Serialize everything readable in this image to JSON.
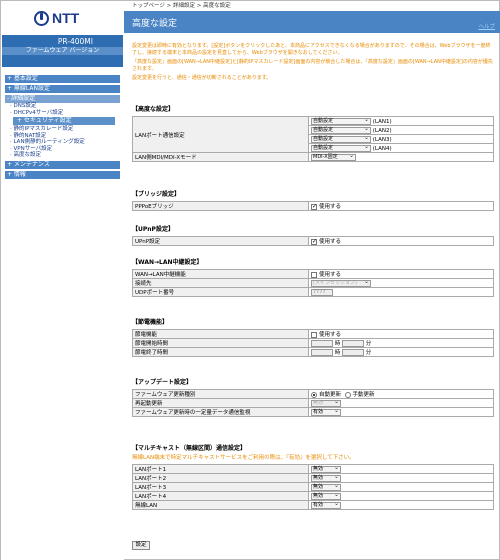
{
  "header": {
    "logo": "NTT",
    "model": "PR-400MI",
    "firmware_label": "ファームウェア バージョン",
    "firmware_version": " "
  },
  "nav": {
    "basic": "+ 基本設定",
    "wlan": "+ 無線LAN設定",
    "detail": "- 詳細設定",
    "detail_items_1": [
      "· DNS設定",
      "· DHCPv4サーバ設定"
    ],
    "security": "+ セキュリティ設定",
    "detail_items_2": [
      "· 静的IPマスカレード設定",
      "· 静的NAT設定",
      "· LAN側静的ルーティング設定",
      "· VPNサーバ設定",
      "· 高度な設定"
    ],
    "maintenance": "+ メンテナンス",
    "info": "+ 情報"
  },
  "breadcrumb": "トップページ > 詳細設定 > 高度な設定",
  "page": {
    "title": "高度な設定",
    "help": "ヘルプ"
  },
  "intro": [
    "設定変更は即時に有効となります。[設定]ボタンをクリックしたあと、本商品にアクセスできなくなる場合がありますので、その場合は、Webブラウザを一度終了し、接続する端末と本商品の設定を見直してから、Webブラウザを開きなおしてください。",
    "『高度な設定』画面の[WAN→LAN中継設定]と[静的IPマスカレード設定]画面の内容が競合した場合は、『高度な設定』画面の[WAN→LAN中継設定]の内容が優先されます。",
    "設定変更を行うと、通信・通信が切断されることがあります。"
  ],
  "advanced": {
    "heading": "【高度な設定】",
    "lan_port_label": "LANポート通信設定",
    "ports": [
      {
        "value": "自動設定",
        "name": "(LAN1)"
      },
      {
        "value": "自動設定",
        "name": "(LAN2)"
      },
      {
        "value": "自動設定",
        "name": "(LAN3)"
      },
      {
        "value": "自動設定",
        "name": "(LAN4)"
      }
    ],
    "mdi_label": "LAN側MDI/MDI-Xモード",
    "mdi_value": "MDI-X固定"
  },
  "bridge": {
    "heading": "【ブリッジ設定】",
    "label": "PPPoEブリッジ",
    "option": "使用する"
  },
  "upnp": {
    "heading": "【UPnP設定】",
    "label": "UPnP設定",
    "option": "使用する"
  },
  "wan": {
    "heading": "【WAN→LAN中継設定】",
    "relay_label": "WAN→LAN中継機能",
    "relay_option": "使用する",
    "dest_label": "接続先",
    "dest_value": "(メインセッション)",
    "udp_label": "UDPポート番号",
    "udp_value": "7777"
  },
  "power": {
    "heading": "【節電機能】",
    "func_label": "節電機能",
    "func_option": "使用する",
    "start_label": "節電開始時間",
    "end_label": "節電終了時間",
    "hour_unit": "時",
    "min_unit": "分"
  },
  "update": {
    "heading": "【アップデート設定】",
    "type_label": "ファームウェア更新種別",
    "auto": "自動更新",
    "manual": "手動更新",
    "restart_label": "再起動更新",
    "restart_value": "無効",
    "monitor_label": "ファームウェア更新時の一定量データ通信監視",
    "monitor_value": "有効"
  },
  "multicast": {
    "heading": "【マルチキャスト（無線区間）通信設定】",
    "note": "無線LAN端末で特定マルチキャストサービスをご利用の際は、『有効』を選択して下さい。",
    "rows": [
      {
        "label": "LANポート1",
        "value": "無効"
      },
      {
        "label": "LANポート2",
        "value": "無効"
      },
      {
        "label": "LANポート3",
        "value": "無効"
      },
      {
        "label": "LANポート4",
        "value": "無効"
      },
      {
        "label": "無線LAN",
        "value": "有効"
      }
    ]
  },
  "submit": "設定"
}
